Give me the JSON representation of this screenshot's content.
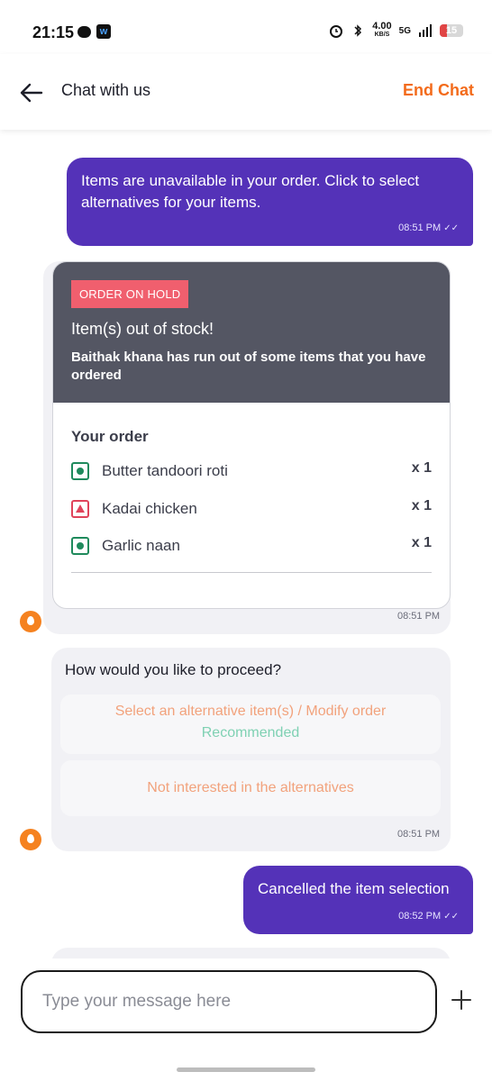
{
  "status_bar": {
    "time": "21:15",
    "net_speed": "4.00",
    "net_unit": "KB/S",
    "signal_text": "5G",
    "battery": "15"
  },
  "header": {
    "title": "Chat with us",
    "end_chat_label": "End Chat"
  },
  "messages": {
    "m1": {
      "text": "Items are unavailable in your order. Click to select alternatives for your items.",
      "time": "08:51 PM",
      "ticks": "✓✓"
    },
    "order_card": {
      "badge": "ORDER ON HOLD",
      "title": "Item(s) out of stock!",
      "description": "Baithak khana has run out of some items that you have ordered",
      "your_order_label": "Your order",
      "items": [
        {
          "name": "Butter tandoori roti",
          "qty": "x 1",
          "type": "veg"
        },
        {
          "name": "Kadai chicken",
          "qty": "x 1",
          "type": "non-veg"
        },
        {
          "name": "Garlic naan",
          "qty": "x 1",
          "type": "veg"
        }
      ],
      "time": "08:51 PM"
    },
    "proceed": {
      "question": "How would you like to proceed?",
      "option1": "Select an alternative item(s) / Modify order",
      "option1_tag": "Recommended",
      "option2": "Not interested in the alternatives",
      "time": "08:51 PM"
    },
    "m2": {
      "text": "Cancelled the item selection",
      "time": "08:52 PM",
      "ticks": "✓✓"
    }
  },
  "input": {
    "placeholder": "Type your message here"
  },
  "colors": {
    "user_bubble": "#5432b8",
    "accent": "#f36b1b",
    "hold_badge": "#f05f6e",
    "card_header": "#545663"
  }
}
